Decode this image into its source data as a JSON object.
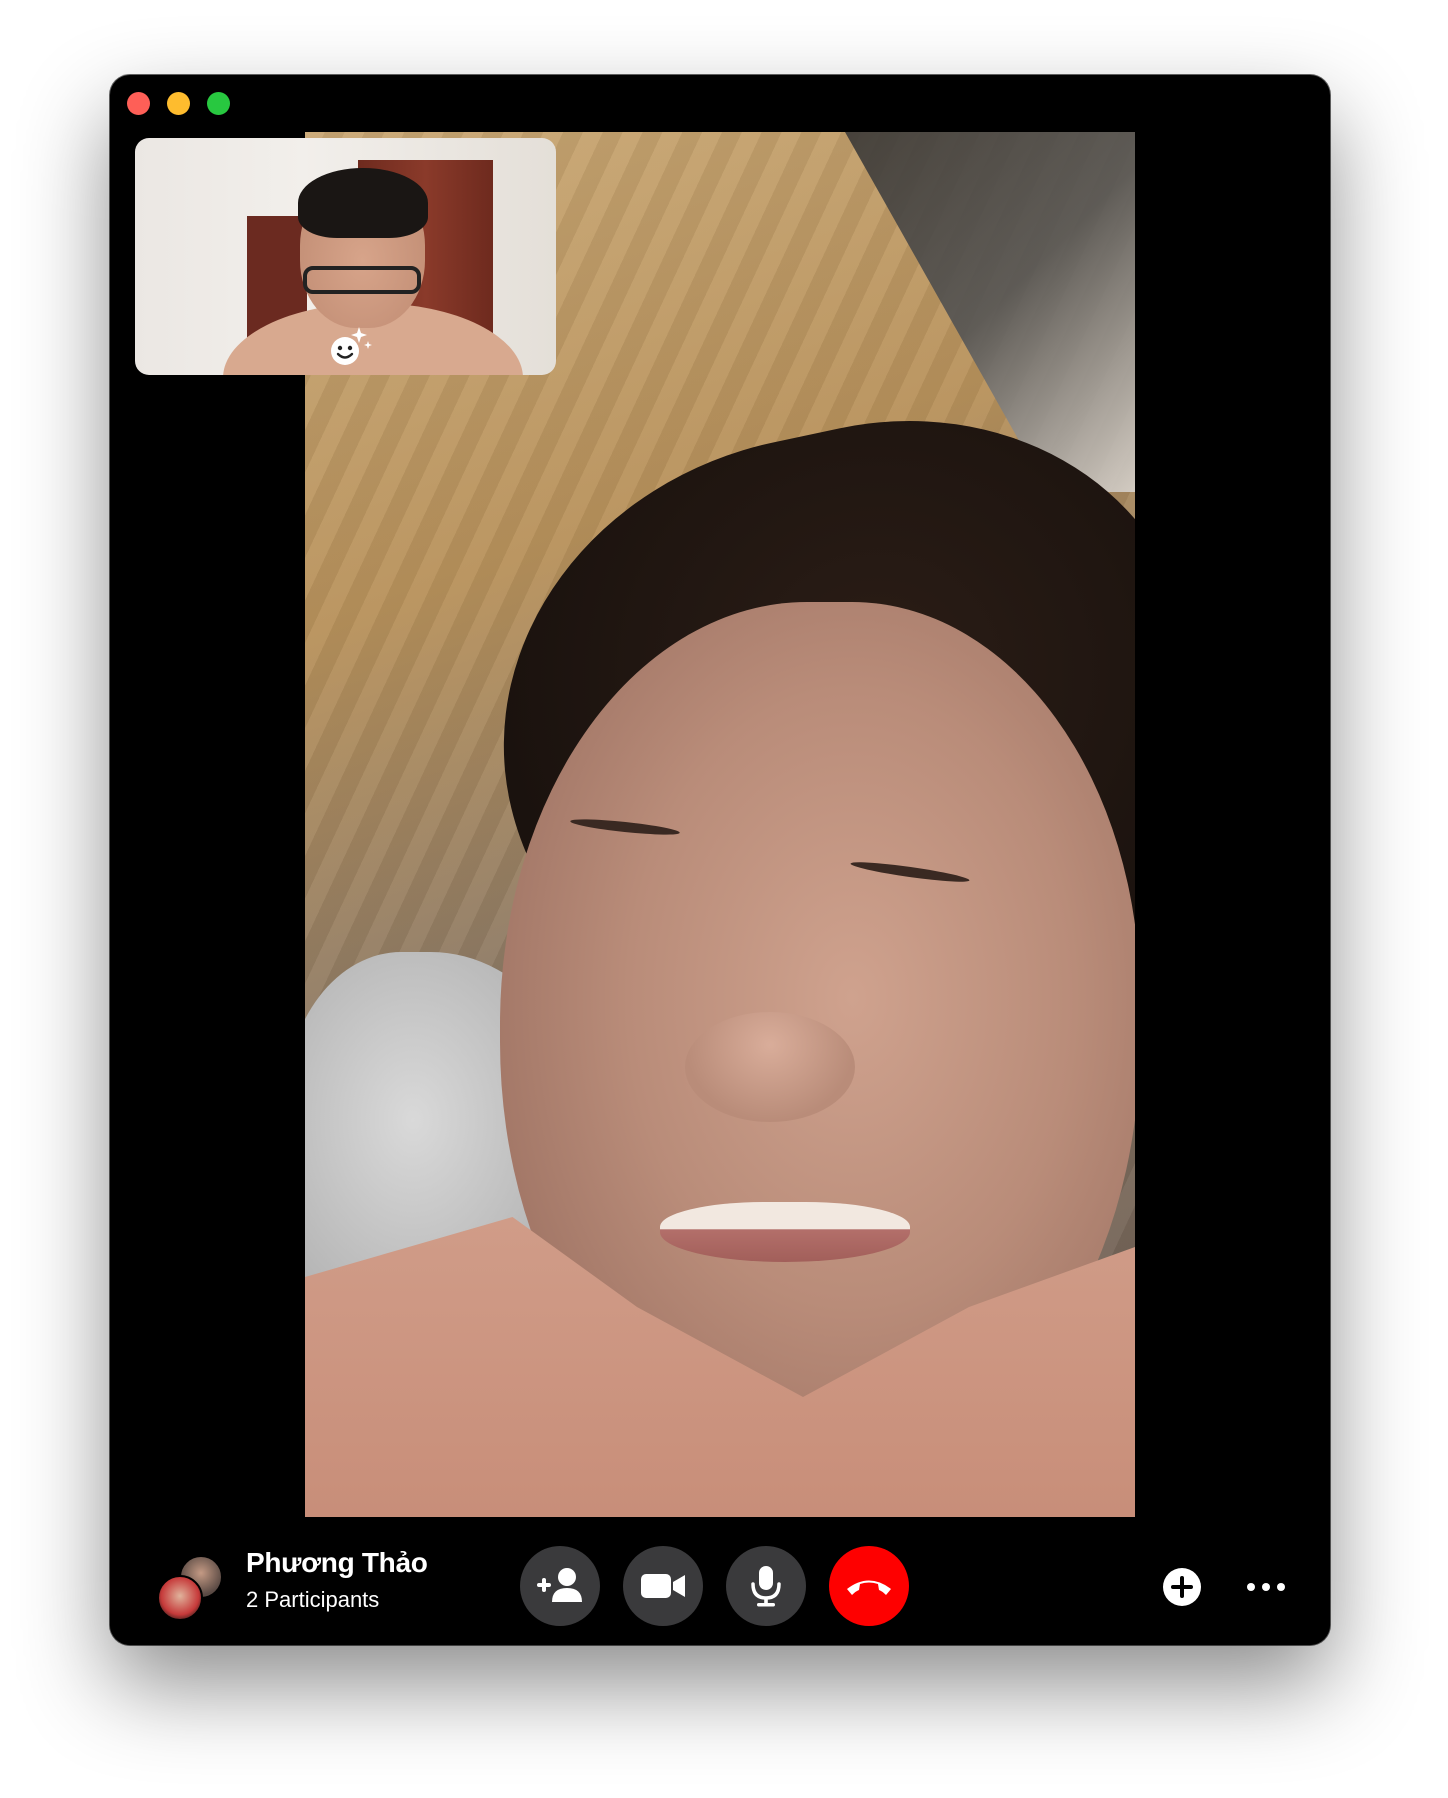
{
  "window": {
    "controls": [
      "close",
      "minimize",
      "zoom"
    ]
  },
  "call": {
    "name": "Phương Thảo",
    "participants_label": "2 Participants"
  },
  "buttons": {
    "add_person": "person-add-icon",
    "video": "video-camera-icon",
    "mute": "microphone-icon",
    "end_call": "phone-hangup-icon",
    "add": "plus-circle-icon",
    "more": "ellipsis-icon"
  },
  "colors": {
    "end_call": "#fe0000",
    "control_bg": "#3a3a3c",
    "traffic_close": "#fe5f57",
    "traffic_min": "#febc2e",
    "traffic_max": "#28c840"
  }
}
